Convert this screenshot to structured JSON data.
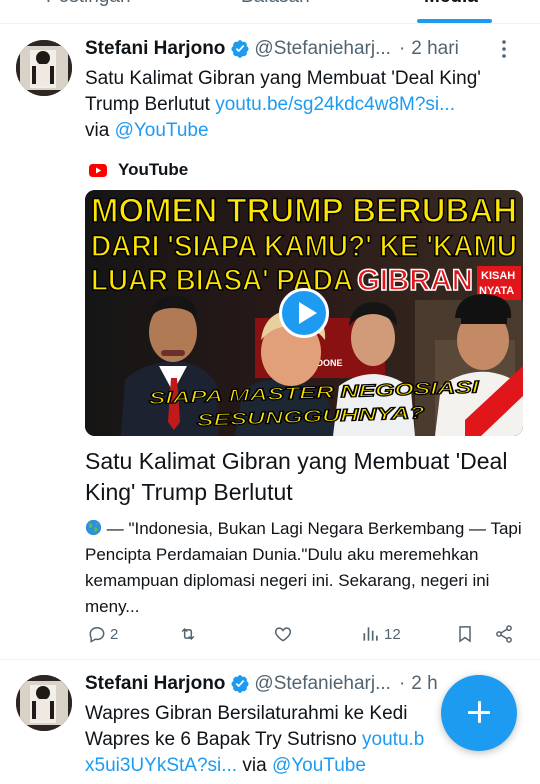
{
  "tabs": [
    {
      "label": "Postingan",
      "selected": false
    },
    {
      "label": "Balasan",
      "selected": false
    },
    {
      "label": "Media",
      "selected": true
    }
  ],
  "colors": {
    "accent": "#1d9bf0",
    "text": "#0f1419",
    "secondary": "#536471",
    "youtube_red": "#ff0000"
  },
  "tweets": [
    {
      "author_name": "Stefani Harjono",
      "handle": "@Stefanieharj...",
      "separator": "·",
      "time": "2 hari",
      "text_pre": "Satu Kalimat Gibran yang Membuat 'Deal King' Trump Berlutut ",
      "link": "youtu.be/sg24kdc4w8M?si...",
      "via_text": "via ",
      "via_link": "@YouTube",
      "card": {
        "source_icon": "youtube-icon",
        "source": "YouTube",
        "thumbnail": {
          "line1": "MOMEN TRUMP BERUBAH",
          "line2": "DARI 'SIAPA KAMU?' KE 'KAMU",
          "line3a": "LUAR BIASA' PADA ",
          "line3b": "GIBRAN",
          "badge1": "KISAH",
          "badge2": "NYATA",
          "caption1": "SIAPA MASTER NEGOSIASI",
          "caption2": "SESUNGGUHNYA?",
          "bg_text": "NEANK INDONE"
        },
        "title": "Satu Kalimat Gibran yang Membuat 'Deal King' Trump Berlutut",
        "desc_icon": "globe-icon",
        "description": " — \"Indonesia, Bukan Lagi Negara Berkembang — Tapi Pencipta Perdamaian Dunia.\"Dulu aku meremehkan kemampuan diplomasi negeri ini. Sekarang, negeri ini meny..."
      },
      "actions": {
        "replies": "2",
        "reposts": "",
        "likes": "",
        "views": "12"
      }
    },
    {
      "author_name": "Stefani Harjono",
      "handle": "@Stefanieharj...",
      "separator": "·",
      "time": "2 h",
      "line1": "Wapres Gibran Bersilaturahmi ke Kedi",
      "line2_pre": "Wapres ke 6 Bapak Try Sutrisno ",
      "line2_link": "youtu.b",
      "line3_link": "x5ui3UYkStA?si...",
      "via_text": " via ",
      "via_link": "@YouTube"
    }
  ],
  "fab": {
    "icon": "plus-icon"
  }
}
